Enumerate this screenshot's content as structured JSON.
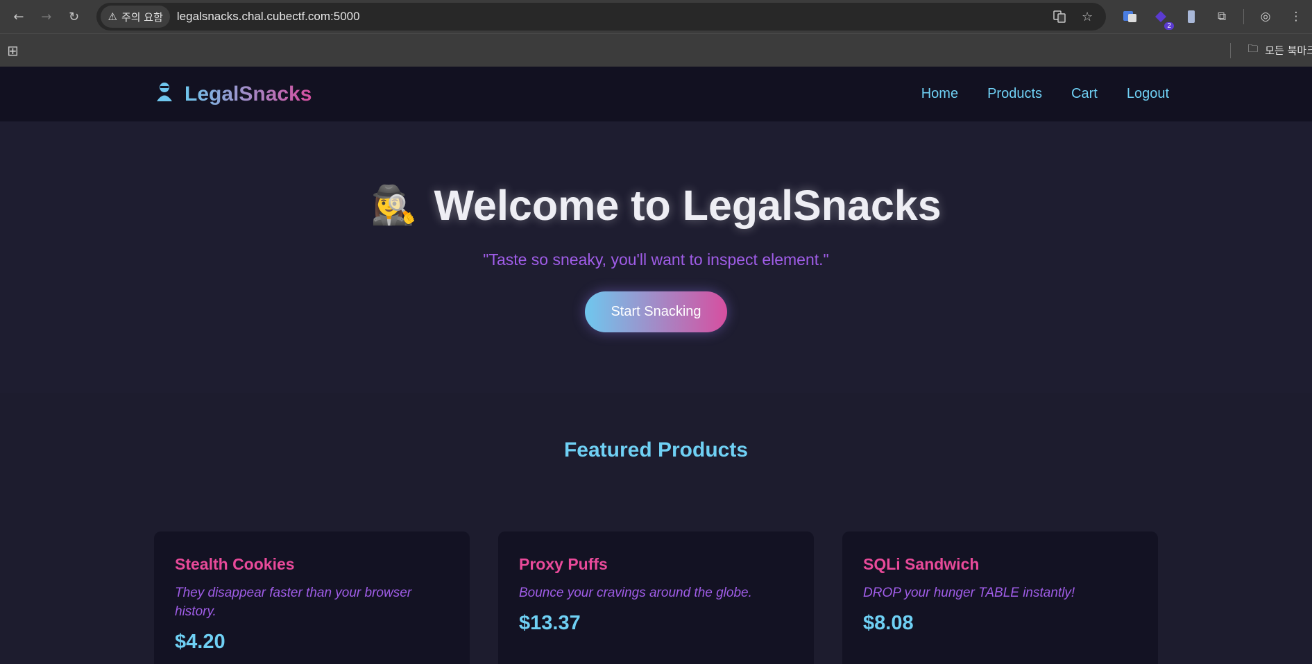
{
  "browser": {
    "security_label": "주의 요함",
    "url": "legalsnacks.chal.cubectf.com:5000",
    "extension_badge": "2",
    "bookmarks_folder": "모든 북마크"
  },
  "site": {
    "logo_text": "LegalSnacks",
    "nav": [
      "Home",
      "Products",
      "Cart",
      "Logout"
    ]
  },
  "hero": {
    "emoji": "🕵️‍♀️",
    "heading": "Welcome to LegalSnacks",
    "tagline": "\"Taste so sneaky, you'll want to inspect element.\"",
    "cta_label": "Start Snacking"
  },
  "featured": {
    "title": "Featured Products",
    "products": [
      {
        "name": "Stealth Cookies",
        "description": "They disappear faster than your browser history.",
        "price": "$4.20"
      },
      {
        "name": "Proxy Puffs",
        "description": "Bounce your cravings around the globe.",
        "price": "$13.37"
      },
      {
        "name": "SQLi Sandwich",
        "description": "DROP your hunger TABLE instantly!",
        "price": "$8.08"
      }
    ]
  },
  "colors": {
    "accent_cyan": "#6fd0f4",
    "accent_pink": "#e94a9a",
    "accent_purple": "#a05de8",
    "page_bg": "#1d1c2e"
  }
}
